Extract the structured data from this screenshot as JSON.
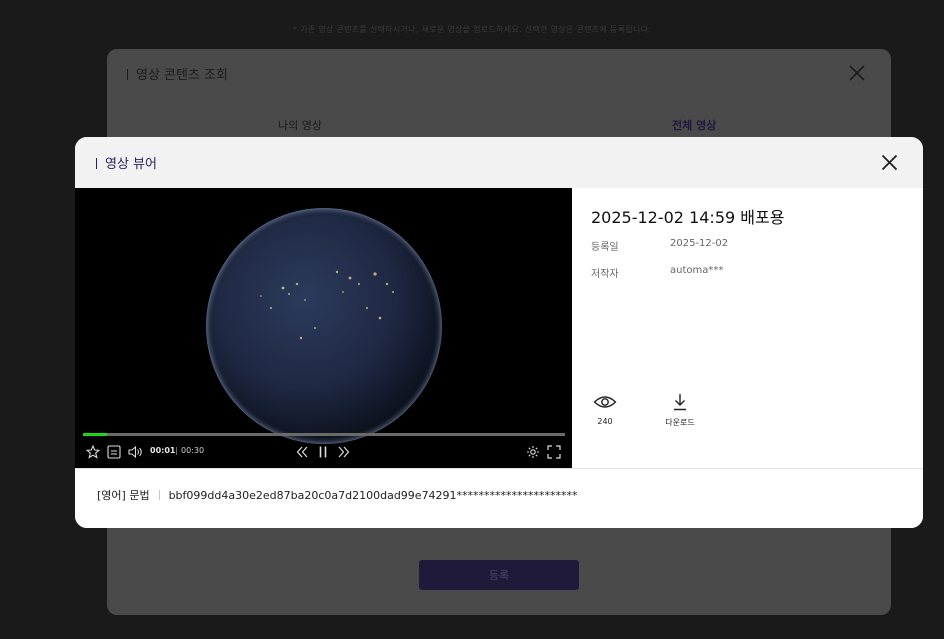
{
  "background": {
    "notice": "* 기존 영상 콘텐츠를 선택하시거나, 새로운 영상을 업로드하세요. 선택한 영상은 콘텐츠에 등록됩니다.",
    "modal_title": "영상 콘텐츠 조회",
    "tabs": [
      {
        "label": "나의 영상"
      },
      {
        "label": "전체 영상"
      }
    ],
    "register_label": "등록"
  },
  "viewer": {
    "title": "영상 뷰어",
    "video": {
      "current_time": "00:01",
      "separator": "|",
      "duration": "00:30",
      "progress_fraction": 0.05,
      "progress_color": "#1bd51b"
    },
    "info": {
      "title": "2025-12-02 14:59 배포용",
      "registered_label": "등록일",
      "registered_value": "2025-12-02",
      "author_label": "저작자",
      "author_value": "automa***"
    },
    "stats": {
      "views_icon": "eye-icon",
      "views": "240",
      "download_icon": "download-icon",
      "download_label": "다운로드"
    },
    "footer": {
      "category": "[영어] 문법",
      "video_id": "bbf099dd4a30e2ed87ba20c0a7d2100dad99e74291**********************"
    }
  },
  "colors": {
    "accent": "#2a1f5c",
    "header_bg": "#f2f2f2",
    "register_button": "#1f1a3a"
  }
}
